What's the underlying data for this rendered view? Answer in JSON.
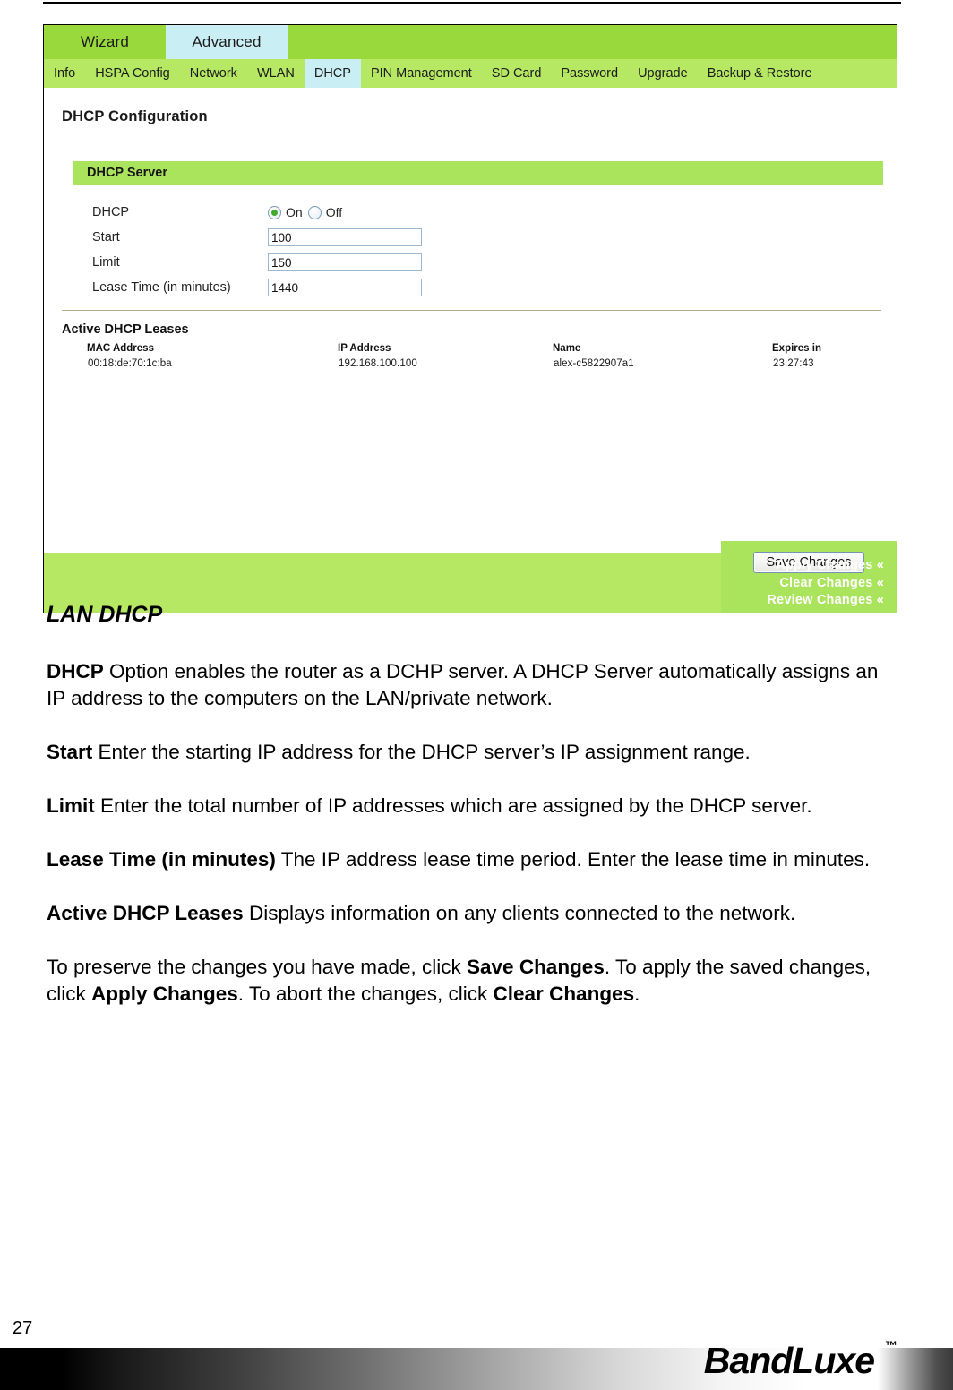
{
  "router_ui": {
    "main_tabs": [
      {
        "label": "Wizard",
        "active": false
      },
      {
        "label": "Advanced",
        "active": true
      }
    ],
    "sub_tabs": [
      {
        "label": "Info",
        "active": false
      },
      {
        "label": "HSPA Config",
        "active": false
      },
      {
        "label": "Network",
        "active": false
      },
      {
        "label": "WLAN",
        "active": false
      },
      {
        "label": "DHCP",
        "active": true
      },
      {
        "label": "PIN Management",
        "active": false
      },
      {
        "label": "SD Card",
        "active": false
      },
      {
        "label": "Password",
        "active": false
      },
      {
        "label": "Upgrade",
        "active": false
      },
      {
        "label": "Backup & Restore",
        "active": false
      }
    ],
    "page_title": "DHCP Configuration",
    "section_title": "DHCP Server",
    "form": {
      "dhcp_label": "DHCP",
      "dhcp_on_label": "On",
      "dhcp_off_label": "Off",
      "dhcp_selected": "On",
      "start_label": "Start",
      "start_value": "100",
      "limit_label": "Limit",
      "limit_value": "150",
      "lease_label": "Lease Time (in minutes)",
      "lease_value": "1440"
    },
    "leases": {
      "title": "Active DHCP Leases",
      "columns": [
        "MAC Address",
        "IP Address",
        "Name",
        "Expires in"
      ],
      "rows": [
        {
          "mac": "00:18:de:70:1c:ba",
          "ip": "192.168.100.100",
          "name": "alex-c5822907a1",
          "expires": "23:27:43"
        }
      ]
    },
    "save_button": "Save Changes",
    "action_links": [
      "Apply Changes «",
      "Clear Changes «",
      "Review Changes «"
    ],
    "colors": {
      "tab_green": "#9ad93c",
      "subtab_green": "#b6e863",
      "active_tab": "#c9eff4",
      "section_green": "#aae35c",
      "input_border": "#9bb8d3",
      "radio_on": "#3faa2e"
    }
  },
  "doc": {
    "heading": "LAN DHCP",
    "paragraphs": [
      {
        "term": "DHCP",
        "text": " Option enables the router as a DCHP server. A DHCP Server automatically assigns an IP address to the computers on the LAN/private network."
      },
      {
        "term": "Start",
        "text": " Enter the starting IP address for the DHCP server’s IP assignment range."
      },
      {
        "term": "Limit",
        "text": " Enter the total number of IP addresses which are assigned by the DHCP server."
      },
      {
        "term": "Lease Time (in minutes)",
        "text": " The IP address lease time period. Enter the lease time in minutes."
      },
      {
        "term": "Active DHCP Leases",
        "text": " Displays information on any clients connected to the network."
      }
    ],
    "closing": {
      "part1": "To preserve the changes you have made, click ",
      "bold1": "Save Changes",
      "part2": ". To apply the saved changes, click ",
      "bold2": "Apply Changes",
      "part3": ". To abort the changes, click ",
      "bold3": "Clear Changes",
      "part4": "."
    }
  },
  "footer": {
    "page_number": "27",
    "logo": "BandLuxe",
    "trademark": "™"
  }
}
